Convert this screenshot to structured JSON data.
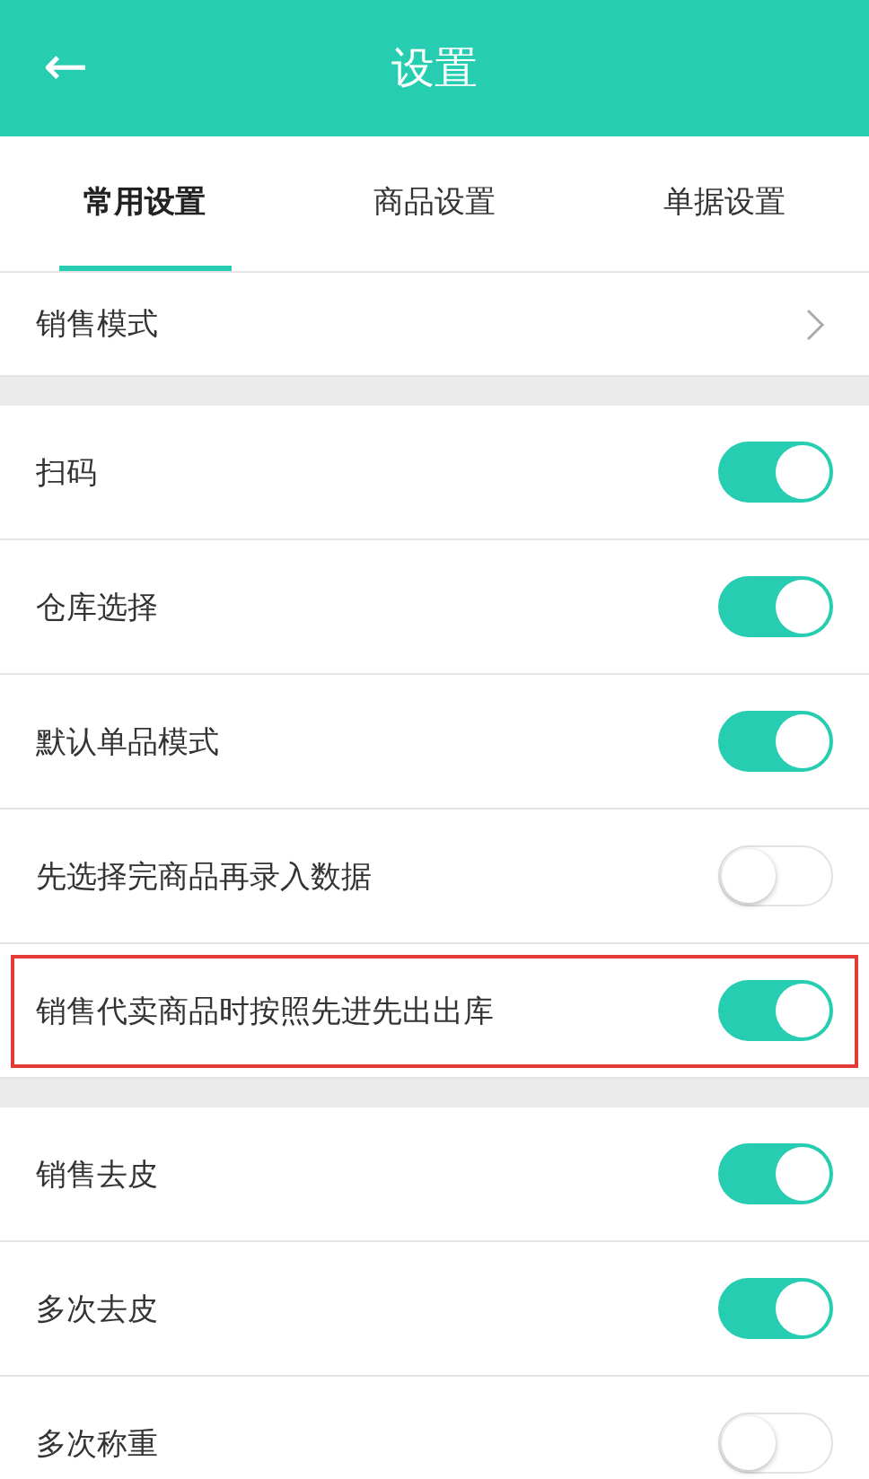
{
  "header": {
    "back_icon": "←",
    "title": "设置"
  },
  "tabs": [
    {
      "label": "常用设置",
      "selected": true
    },
    {
      "label": "商品设置",
      "selected": false
    },
    {
      "label": "单据设置",
      "selected": false
    }
  ],
  "sections": [
    {
      "items": [
        {
          "kind": "nav",
          "label": "销售模式"
        }
      ]
    },
    {
      "items": [
        {
          "kind": "toggle",
          "label": "扫码",
          "on": true,
          "highlighted": false
        },
        {
          "kind": "toggle",
          "label": "仓库选择",
          "on": true,
          "highlighted": false
        },
        {
          "kind": "toggle",
          "label": "默认单品模式",
          "on": true,
          "highlighted": false
        },
        {
          "kind": "toggle",
          "label": "先选择完商品再录入数据",
          "on": false,
          "highlighted": false
        },
        {
          "kind": "toggle",
          "label": "销售代卖商品时按照先进先出出库",
          "on": true,
          "highlighted": true
        }
      ]
    },
    {
      "items": [
        {
          "kind": "toggle",
          "label": "销售去皮",
          "on": true,
          "highlighted": false
        },
        {
          "kind": "toggle",
          "label": "多次去皮",
          "on": true,
          "highlighted": false
        },
        {
          "kind": "toggle",
          "label": "多次称重",
          "on": false,
          "highlighted": false
        }
      ]
    }
  ]
}
